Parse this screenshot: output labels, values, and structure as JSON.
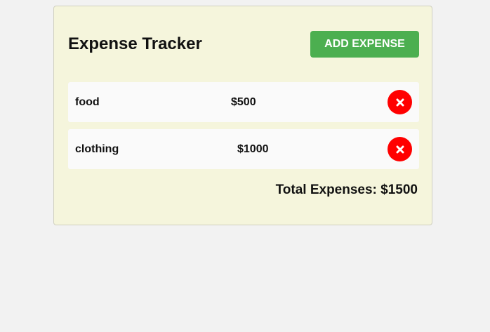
{
  "header": {
    "title": "Expense Tracker",
    "add_button_label": "ADD EXPENSE"
  },
  "expenses": [
    {
      "name": "food",
      "amount": "$500",
      "delete_icon": "close-icon"
    },
    {
      "name": "clothing",
      "amount": "$1000",
      "delete_icon": "close-icon"
    }
  ],
  "footer": {
    "total_text": "Total Expenses: $1500"
  },
  "colors": {
    "page_background": "#f2f2f2",
    "card_background": "#f5f5dc",
    "add_button": "#4caf50",
    "delete_button": "#ff0000",
    "row_background": "#fafafa"
  }
}
